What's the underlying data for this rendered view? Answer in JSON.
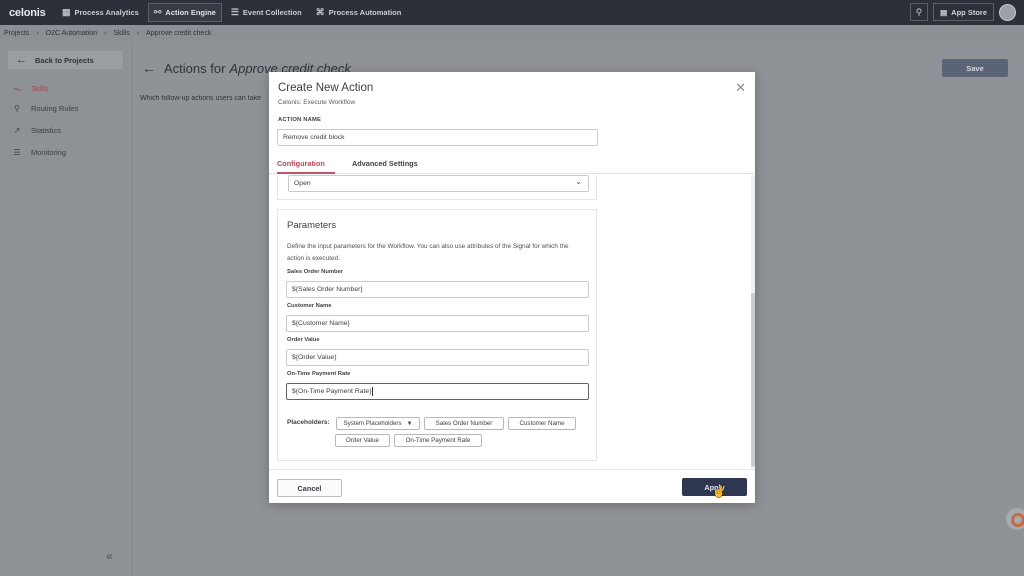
{
  "topbar": {
    "logo": "celonis",
    "nav": [
      {
        "label": "Process Analytics",
        "icon": "grid-icon"
      },
      {
        "label": "Action Engine",
        "icon": "link-icon"
      },
      {
        "label": "Event Collection",
        "icon": "database-icon"
      },
      {
        "label": "Process Automation",
        "icon": "flow-icon"
      }
    ],
    "app_store": "App Store"
  },
  "breadcrumb": [
    "Projects",
    "O2C Automation",
    "Skills",
    "Approve credit check"
  ],
  "sidebar": {
    "back": "Back to Projects",
    "items": [
      {
        "label": "Skills",
        "icon": "skills-icon"
      },
      {
        "label": "Routing Rules",
        "icon": "routing-icon"
      },
      {
        "label": "Statistics",
        "icon": "statistics-icon"
      },
      {
        "label": "Monitoring",
        "icon": "monitoring-icon"
      }
    ]
  },
  "main": {
    "title_prefix": "Actions for",
    "title_skill": "Approve credit check",
    "description": "Which follow-up actions users can take",
    "save": "Save"
  },
  "modal": {
    "title": "Create New Action",
    "subtitle": "Celonis: Execute Workflow",
    "action_name_label": "ACTION NAME",
    "action_name_value": "Remove credit block",
    "tabs": [
      "Configuration",
      "Advanced Settings"
    ],
    "select_value": "Open",
    "params": {
      "title": "Parameters",
      "description": "Define the input parameters for the Workflow. You can also use attributes of the Signal for which the action is executed.",
      "fields": [
        {
          "label": "Sales Order Number",
          "value": "${Sales Order Number}"
        },
        {
          "label": "Customer Name",
          "value": "${Customer Name}"
        },
        {
          "label": "Order Value",
          "value": "${Order Value}"
        },
        {
          "label": "On-Time Payment Rate",
          "value": "${On-Time Payment Rate}"
        }
      ]
    },
    "placeholders_label": "Placeholders:",
    "placeholder_chips": [
      "System Placeholders",
      "Sales Order Number",
      "Customer Name",
      "Order Value",
      "On-Time Payment Rate"
    ],
    "cancel": "Cancel",
    "apply": "Apply"
  }
}
